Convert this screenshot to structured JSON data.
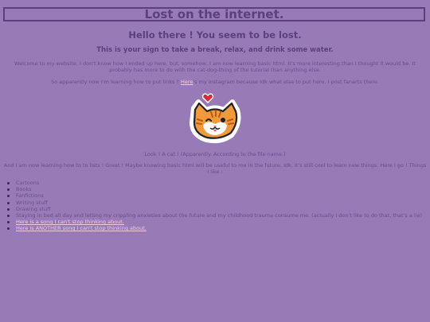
{
  "header": {
    "title": "Lost on the internet."
  },
  "greeting": "Hello there ! You seem to be lost.",
  "sign": "This is your sign to take a break, relax, and drink some water.",
  "intro": "Welcome to my website. I don't know how I ended up here, but, somehow, I am now learning basic html. It's more interesting than I thought it would be. It probably has more to do with the cat-dog-thing of the tutorial than anything else.",
  "links_para": {
    "before": "So apparently now I'm learning how to put links ? ",
    "link": "Here",
    "after": "'s my instagram because Idk what else to put here. I post fanarts there."
  },
  "cat_image": {
    "icon": "cat-face-with-heart-icon"
  },
  "cat_caption": "Look ! A cat ! (Apparently. According to the file name.)",
  "lists_para": "And I am now learning how to to lists ! Great ! Maybe knowing basic html will be useful to me in the future. Idk. It's still cool to learn new things. Here I go ! Things I like :",
  "likes": [
    "Cartoons",
    "Books",
    "Fanfictions",
    "Writing stuff",
    "Drawing stuff",
    "Staying in bed all day and letting my crippling anxieties about the future and my childhood trauma consume me. (actually I don't like to do that, that's a lie)"
  ],
  "song_links": [
    "Here is a song I can't stop thinking about.",
    "Here is ANOTHER song I can't stop thinking about."
  ],
  "colors": {
    "background": "#987bb6",
    "text": "#5b3f7e",
    "link": "#f3c6e8",
    "cat_orange": "#f29a3a"
  }
}
